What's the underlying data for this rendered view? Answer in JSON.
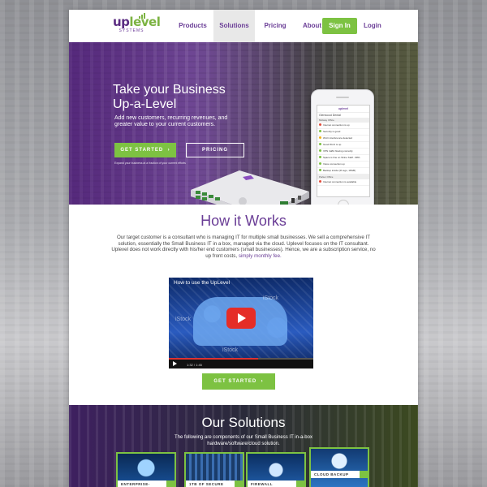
{
  "header": {
    "logo_text": "uplevel",
    "logo_sub": "SYSTEMS",
    "nav": [
      "Products",
      "Solutions",
      "Pricing",
      "About"
    ],
    "active_nav": "Solutions",
    "signin": "Sign In",
    "login": "Login"
  },
  "hero": {
    "title": "Take your Business Up-a-Level",
    "subtitle": "Add new customers, recurring revenues, and greater value to your current customers.",
    "cta_primary": "GET STARTED",
    "cta_secondary": "PRICING",
    "fine_print": "Expand your business at a fraction of your current efforts"
  },
  "phone": {
    "app_title": "uplevel",
    "location": "Glenwood Dental",
    "section1": "Midway Office",
    "rows": [
      {
        "text": "Internet connection is up",
        "status": "red"
      },
      {
        "text": "Security is good",
        "status": "green"
      },
      {
        "text": "Wi-Fi interference detected",
        "status": "amber"
      },
      {
        "text": "Good Wi-Fi is up",
        "status": "green"
      },
      {
        "text": "VPN traffic flowing correctly",
        "status": "green"
      },
      {
        "text": "Space is fine on Shine Staff - 98%",
        "status": "green"
      },
      {
        "text": "Voice connection up",
        "status": "green"
      },
      {
        "text": "Backup inside (2h ago, 18GB)",
        "status": "green"
      }
    ],
    "section2": "Parker Office",
    "rows2": [
      {
        "text": "Internet connection is available",
        "status": "red"
      }
    ]
  },
  "how": {
    "title": "How it Works",
    "text": "Our target customer is a consultant who is managing IT for multiple small businesses. We sell a comprehensive IT solution, essentially the Small Business IT in a box, managed via the cloud. Uplevel focuses on the IT consultant. Uplevel does not work directly with his/her end customers (small businesses). Hence, we are a subscription service, no up front costs,",
    "link": "simply monthly fee.",
    "video_title": "How to use the UpLevel",
    "video_mark": "iStock",
    "video_time": "1:32 / 1:45",
    "video_progress": 0.62,
    "cta": "GET STARTED"
  },
  "solutions": {
    "title": "Our Solutions",
    "subtitle": "The following are components of our Small Business IT in-a-box hardware/software/cloud solution.",
    "cards": [
      "ENTERPRISE-",
      "1TB OF SECURE",
      "FIREWALL",
      "CLOUD BACKUP"
    ]
  },
  "colors": {
    "accent": "#7dc242",
    "brand": "#6a3d96",
    "video_play": "#e52d27"
  }
}
